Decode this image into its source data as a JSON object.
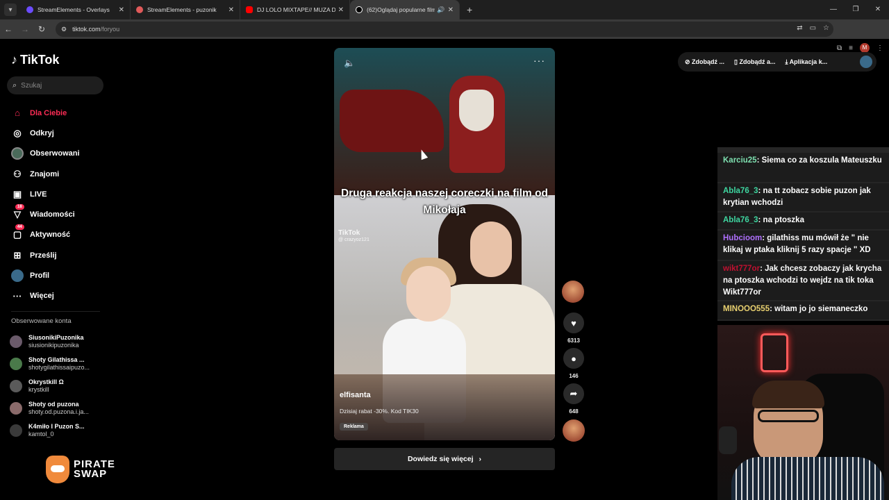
{
  "browser": {
    "tabs": [
      {
        "title": "StreamElements - Overlays",
        "color": "#6b4cff"
      },
      {
        "title": "StreamElements - puzonik",
        "color": "#e05a5a"
      },
      {
        "title": "DJ LOLO MIXTAPE// MUZA DO",
        "color": "#ff0000"
      },
      {
        "title": "(62)Oglądaj popularne filmy",
        "color": "#ffffff"
      }
    ],
    "url_host": "tiktok.com",
    "url_path": "/foryou",
    "profile_initial": "M"
  },
  "sidebar": {
    "brand": "TikTok",
    "search_placeholder": "Szukaj",
    "nav": [
      {
        "label": "Dla Ciebie",
        "icon": "home-icon"
      },
      {
        "label": "Odkryj",
        "icon": "compass-icon"
      },
      {
        "label": "Obserwowani",
        "icon": "following-avatar-icon"
      },
      {
        "label": "Znajomi",
        "icon": "friends-icon"
      },
      {
        "label": "LIVE",
        "icon": "live-icon"
      },
      {
        "label": "Wiadomości",
        "icon": "messages-icon",
        "badge": "18"
      },
      {
        "label": "Aktywność",
        "icon": "activity-icon",
        "badge": "44"
      },
      {
        "label": "Prześlij",
        "icon": "upload-icon"
      },
      {
        "label": "Profil",
        "icon": "profile-icon"
      },
      {
        "label": "Więcej",
        "icon": "more-icon"
      }
    ],
    "following_title": "Obserwowane konta",
    "following": [
      {
        "name": "SiusonikiPuzonika",
        "handle": "siusionikipuzonika"
      },
      {
        "name": "Shoty Gilathissa ...",
        "handle": "shotygilathissaipuzo..."
      },
      {
        "name": "Okrystkill Ω",
        "handle": "krystkill"
      },
      {
        "name": "Shoty od puzona",
        "handle": "shoty.od.puzona.i.ja..."
      },
      {
        "name": "K4miło I Puzon S...",
        "handle": "kamtol_0"
      }
    ],
    "sponsor_logo": "PIRATE SWAP"
  },
  "video": {
    "caption": "Druga reakcja naszej coreczki na film od Mikołaja",
    "watermark": "TikTok",
    "watermark_handle": "@ crazyoz121",
    "author": "elfisanta",
    "description": "Dzisiaj rabat -30%. Kod TIK30",
    "ad_label": "Reklama",
    "learn_more": "Dowiedz się więcej"
  },
  "actions": {
    "likes": "6313",
    "comments": "146",
    "shares": "648"
  },
  "topright": {
    "btn1": "Zdobądź ...",
    "btn2": "Zdobądź a...",
    "btn3": "Aplikacja k..."
  },
  "chat": [
    {
      "user": "Karciu25",
      "color": "#7ee0b0",
      "text": ": Siema co za koszula Mateuszku"
    },
    {
      "user": "Abla76_3",
      "color": "#3ed6a0",
      "text": ": na tt zobacz sobie puzon jak krytian wchodzi"
    },
    {
      "user": "Abla76_3",
      "color": "#3ed6a0",
      "text": ": na ptoszka"
    },
    {
      "user": "Hubcioom",
      "color": "#b070ff",
      "text": ": gilathiss mu mówił że \" nie klikaj w ptaka kliknij 5 razy spacje \" XD"
    },
    {
      "user": "wikt777or",
      "color": "#c01030",
      "text": ": Jak chcesz zobaczy jak krycha na ptoszka wchodzi to wejdz na tik toka Wikt777or"
    },
    {
      "user": "MINOOO555",
      "color": "#e8d070",
      "text": ": witam jo jo siemaneczko"
    }
  ]
}
